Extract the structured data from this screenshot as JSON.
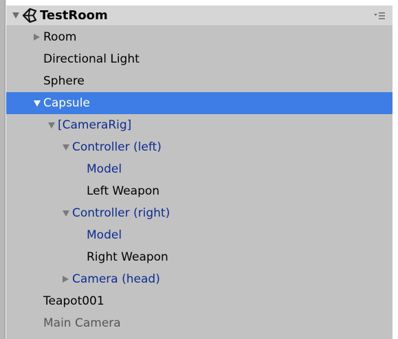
{
  "app": {
    "scene_name": "TestRoom"
  },
  "colors": {
    "selection": "#3e7de6",
    "prefab_text": "#0e2c8f",
    "normal_text": "#000000",
    "disabled_text": "#555555"
  },
  "hierarchy": {
    "items": [
      {
        "label": "Room",
        "fold": "collapsed",
        "style": "normal"
      },
      {
        "label": "Directional Light",
        "fold": "none",
        "style": "normal"
      },
      {
        "label": "Sphere",
        "fold": "none",
        "style": "normal"
      },
      {
        "label": "Capsule",
        "fold": "expanded",
        "style": "selected"
      },
      {
        "label": "[CameraRig]",
        "fold": "expanded",
        "style": "prefab"
      },
      {
        "label": "Controller (left)",
        "fold": "expanded",
        "style": "prefab"
      },
      {
        "label": "Model",
        "fold": "none",
        "style": "prefab"
      },
      {
        "label": "Left Weapon",
        "fold": "none",
        "style": "normal"
      },
      {
        "label": "Controller (right)",
        "fold": "expanded",
        "style": "prefab"
      },
      {
        "label": "Model",
        "fold": "none",
        "style": "prefab"
      },
      {
        "label": "Right Weapon",
        "fold": "none",
        "style": "normal"
      },
      {
        "label": "Camera (head)",
        "fold": "collapsed",
        "style": "prefab"
      },
      {
        "label": "Teapot001",
        "fold": "none",
        "style": "normal"
      },
      {
        "label": "Main Camera",
        "fold": "none",
        "style": "disabled"
      }
    ]
  }
}
